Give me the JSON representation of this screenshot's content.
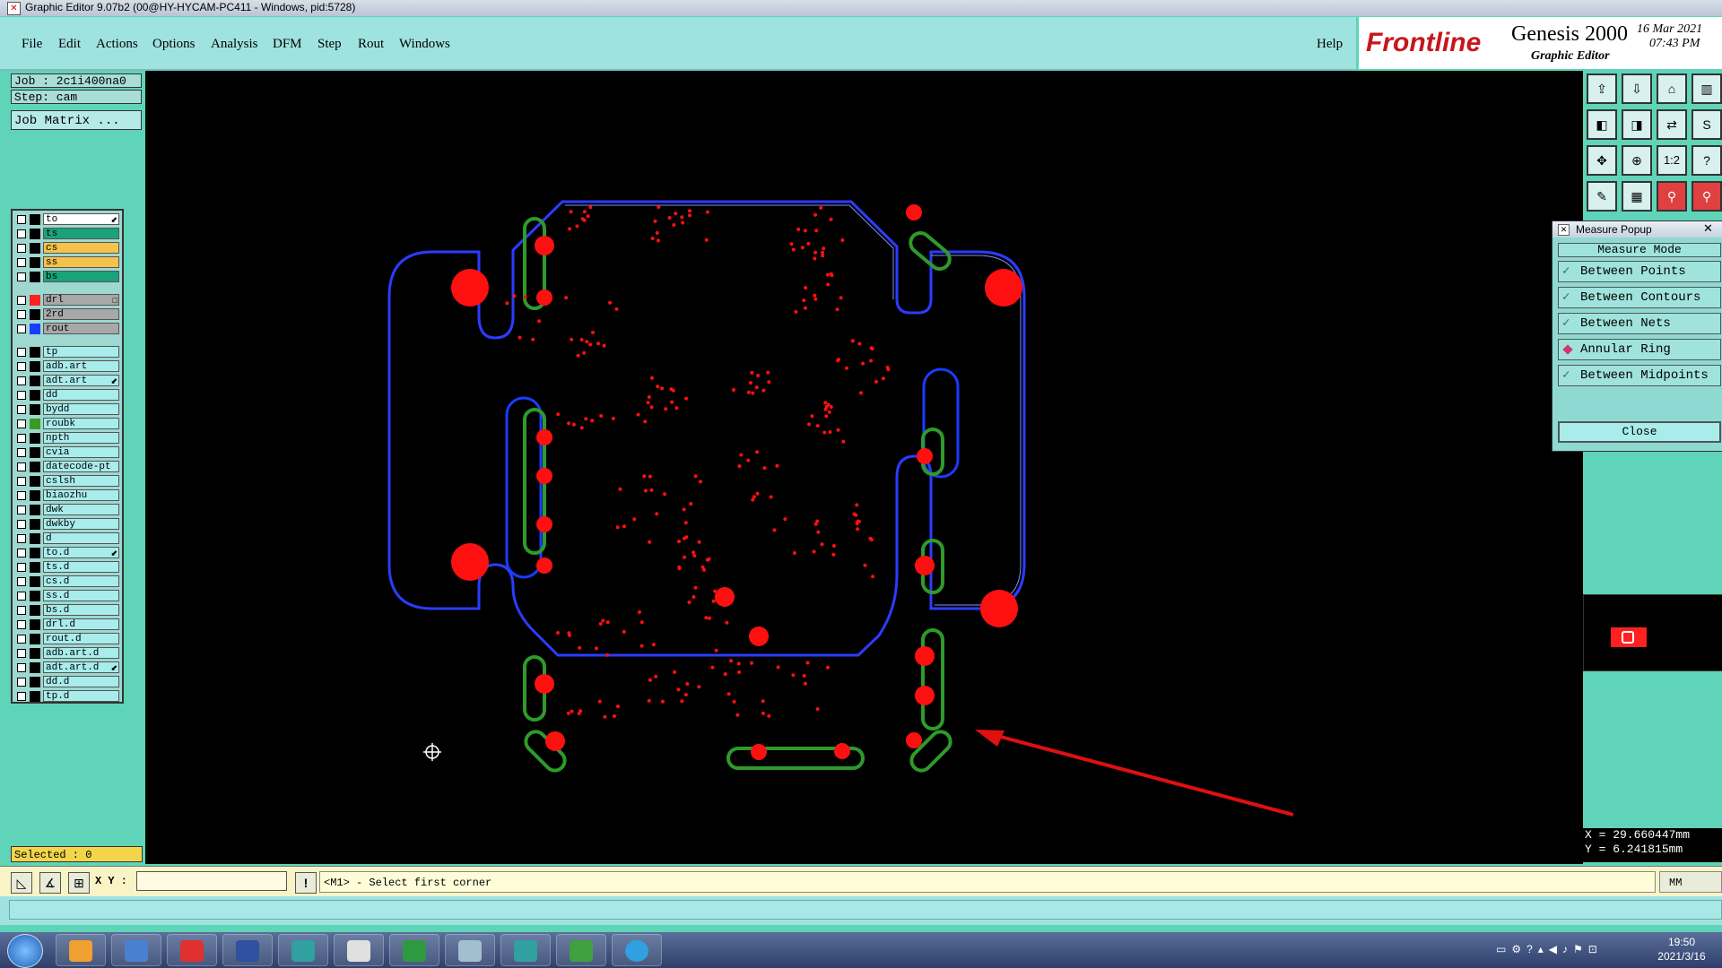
{
  "window": {
    "title": "Graphic Editor 9.07b2 (00@HY-HYCAM-PC411 - Windows, pid:5728)"
  },
  "menu": {
    "items": [
      "File",
      "Edit",
      "Actions",
      "Options",
      "Analysis",
      "DFM",
      "Step",
      "Rout",
      "Windows"
    ],
    "help": "Help"
  },
  "logo": {
    "brand": "Frontline",
    "product": "Genesis 2000",
    "subtitle": "Graphic Editor",
    "date": "16 Mar 2021",
    "time": "07:43 PM"
  },
  "job": {
    "job": "Job : 2c1i400na0",
    "step": "Step: cam",
    "matrix_button": "Job Matrix ..."
  },
  "layers": [
    {
      "name": "to",
      "color": "#ffffff",
      "marker": "⬋"
    },
    {
      "name": "ts",
      "color": "#1aa37a"
    },
    {
      "name": "cs",
      "color": "#f5c24a"
    },
    {
      "name": "ss",
      "color": "#f5c24a"
    },
    {
      "name": "bs",
      "color": "#1aa37a"
    },
    {
      "name": "drl",
      "color": "#a8a8a8",
      "swatch": "#ff2020",
      "marker": "□"
    },
    {
      "name": "2rd",
      "color": "#a8a8a8"
    },
    {
      "name": "rout",
      "color": "#a8a8a8",
      "swatch": "#1a3cff"
    },
    {
      "name": "tp",
      "color": "#a8ecec"
    },
    {
      "name": "adb.art",
      "color": "#a8ecec"
    },
    {
      "name": "adt.art",
      "color": "#a8ecec",
      "marker": "⬋"
    },
    {
      "name": "dd",
      "color": "#a8ecec"
    },
    {
      "name": "bydd",
      "color": "#a8ecec"
    },
    {
      "name": "roubk",
      "color": "#a8ecec",
      "swatch": "#3a9a25"
    },
    {
      "name": "npth",
      "color": "#a8ecec"
    },
    {
      "name": "cvia",
      "color": "#a8ecec"
    },
    {
      "name": "datecode-pt",
      "color": "#a8ecec"
    },
    {
      "name": "cslsh",
      "color": "#a8ecec"
    },
    {
      "name": "biaozhu",
      "color": "#a8ecec"
    },
    {
      "name": "dwk",
      "color": "#a8ecec"
    },
    {
      "name": "dwkby",
      "color": "#a8ecec"
    },
    {
      "name": "d",
      "color": "#a8ecec"
    },
    {
      "name": "to.d",
      "color": "#a8ecec",
      "marker": "⬋"
    },
    {
      "name": "ts.d",
      "color": "#a8ecec"
    },
    {
      "name": "cs.d",
      "color": "#a8ecec"
    },
    {
      "name": "ss.d",
      "color": "#a8ecec"
    },
    {
      "name": "bs.d",
      "color": "#a8ecec"
    },
    {
      "name": "drl.d",
      "color": "#a8ecec"
    },
    {
      "name": "rout.d",
      "color": "#a8ecec"
    },
    {
      "name": "adb.art.d",
      "color": "#a8ecec"
    },
    {
      "name": "adt.art.d",
      "color": "#a8ecec",
      "marker": "⬋"
    },
    {
      "name": "dd.d",
      "color": "#a8ecec"
    },
    {
      "name": "tp.d",
      "color": "#a8ecec"
    }
  ],
  "selected": "Selected : 0",
  "measure": {
    "title": "Measure Popup",
    "mode_label": "Measure Mode",
    "options": [
      {
        "label": "Between Points",
        "active": false
      },
      {
        "label": "Between Contours",
        "active": false
      },
      {
        "label": "Between Nets",
        "active": false
      },
      {
        "label": "Annular Ring",
        "active": true
      },
      {
        "label": "Between Midpoints",
        "active": false
      }
    ],
    "close": "Close"
  },
  "toolbar_icons": [
    "copy-to-icon",
    "paste-icon",
    "home-icon",
    "layout-icon",
    "prev-icon",
    "next-icon",
    "swap-icon",
    "s-icon",
    "zoom-fit-icon",
    "zoom-in-icon",
    "scale-icon",
    "help-icon",
    "snap-icon",
    "grid-icon",
    "net-icon",
    "net2-icon"
  ],
  "toolbar_labels": {
    "scale": "1:2",
    "help": "?"
  },
  "coords": {
    "x": "X = 29.660447mm",
    "y": "Y = 6.241815mm"
  },
  "cmd": {
    "xy_label": "X Y :",
    "input_value": "",
    "prompt": "<M1> - Select first corner",
    "units": "MM"
  },
  "taskbar": {
    "time": "19:50",
    "date": "2021/3/16"
  },
  "colors": {
    "board_outline": "#2c3cff",
    "drill": "#ff1010",
    "slot": "#2e9a2a",
    "background": "#000000",
    "arrow": "#e01010"
  }
}
